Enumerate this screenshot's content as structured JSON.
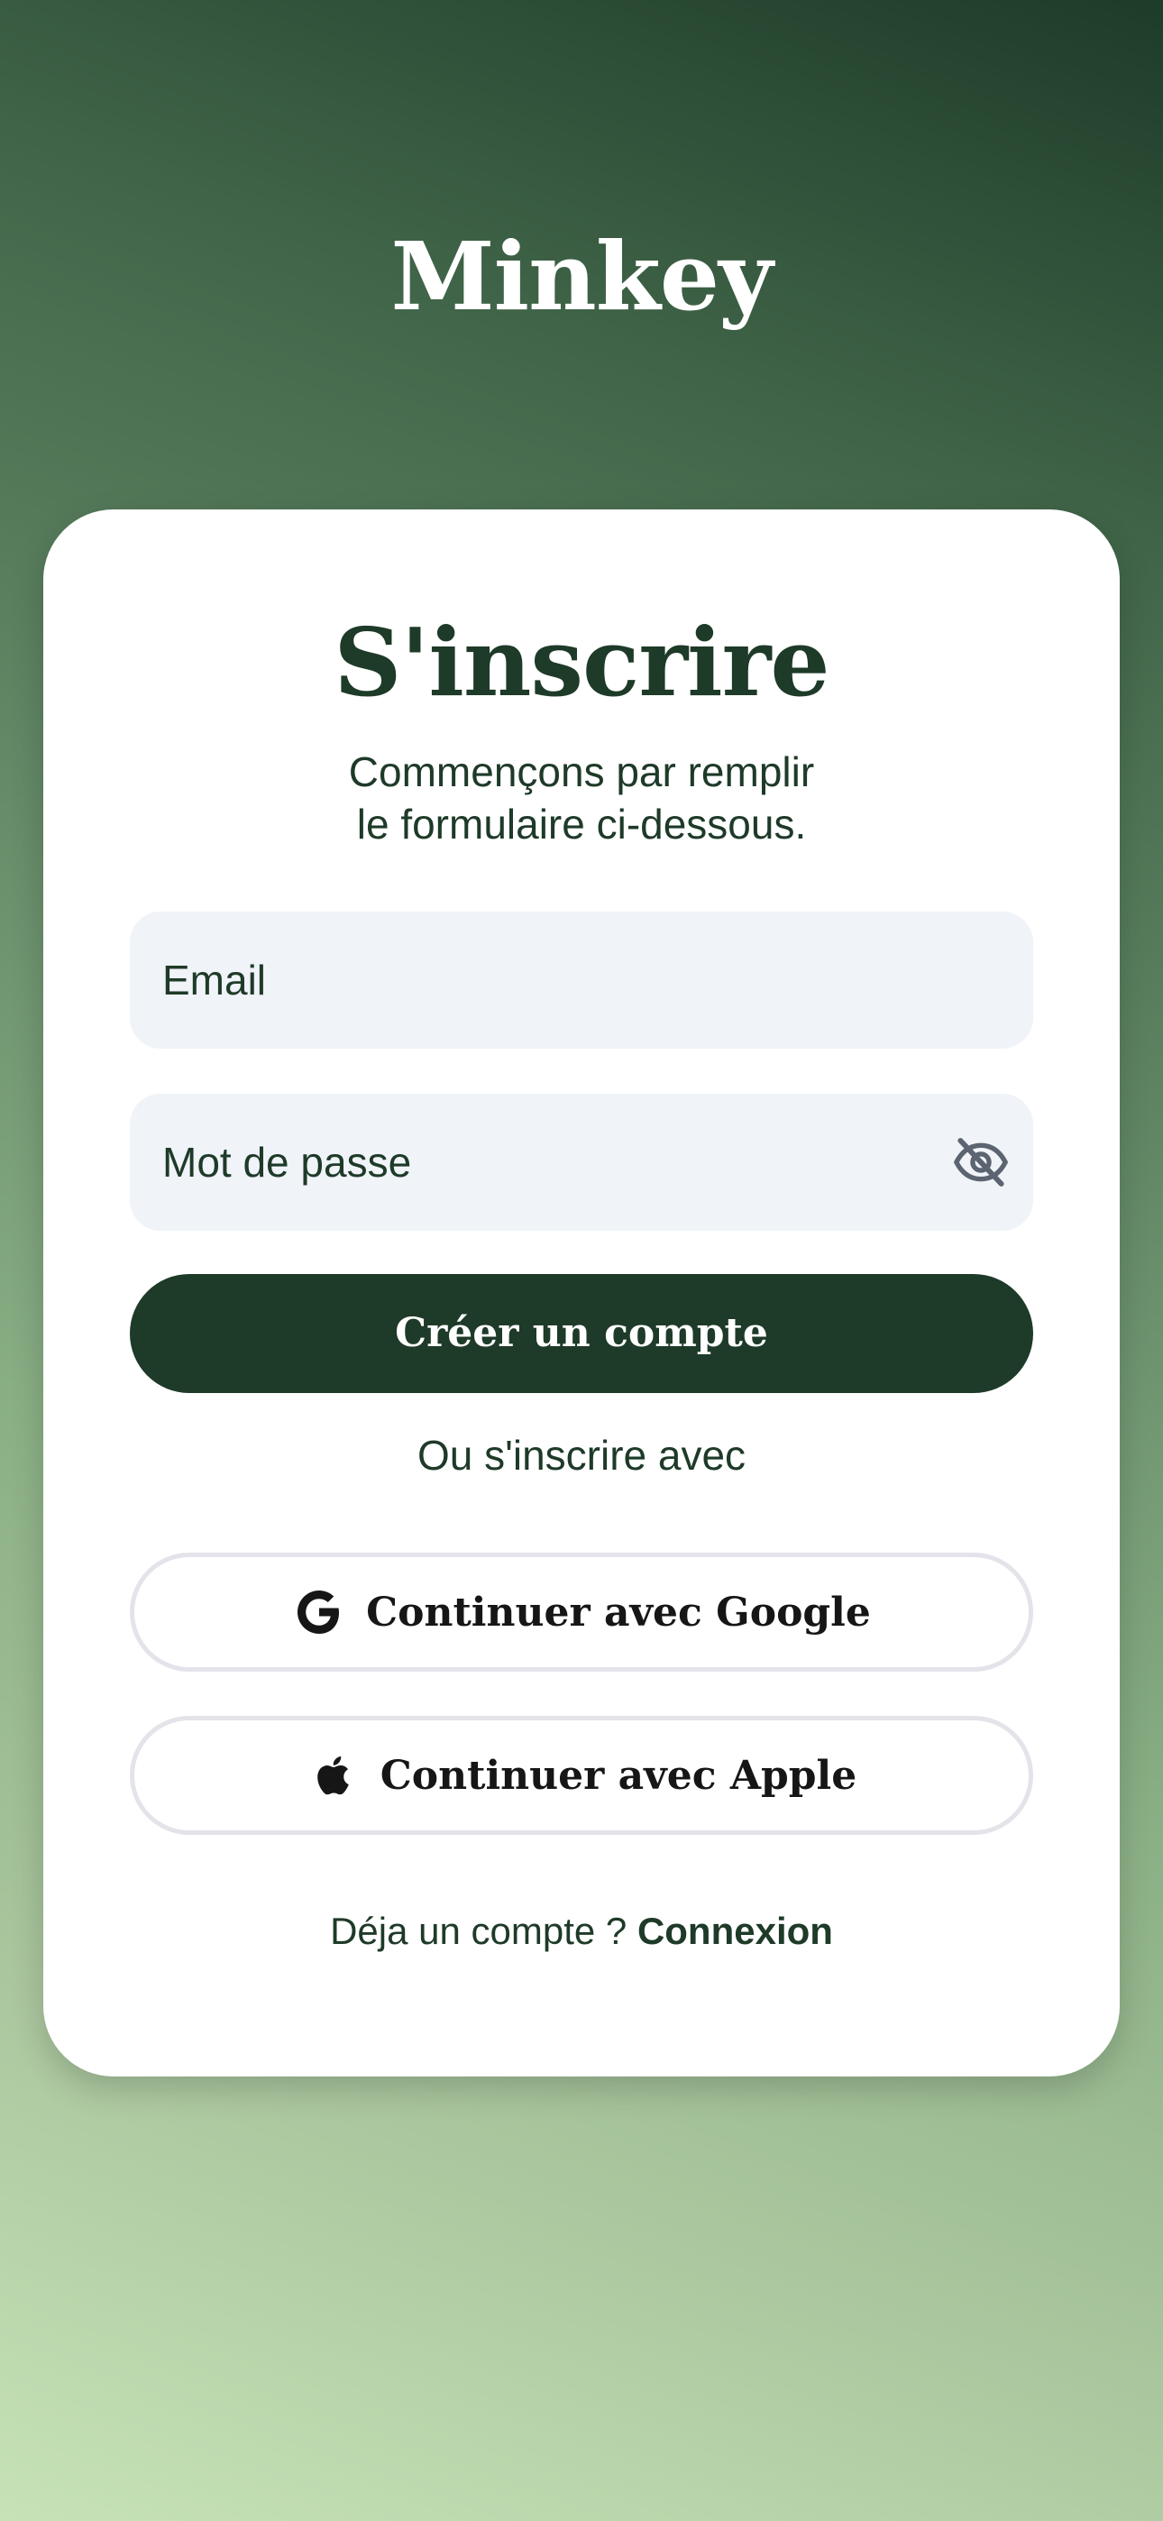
{
  "app": {
    "brand": "Minkey"
  },
  "signup": {
    "title": "S'inscrire",
    "subtitle_line1": "Commençons par remplir",
    "subtitle_line2": "le formulaire ci-dessous.",
    "email_placeholder": "Email",
    "password_placeholder": "Mot de passe",
    "password_toggle_icon": "eye-off-icon",
    "create_button": "Créer un compte",
    "or_text": "Ou s'inscrire avec",
    "google_button": "Continuer avec Google",
    "google_icon": "google-icon",
    "apple_button": "Continuer avec Apple",
    "apple_icon": "apple-icon",
    "footer_prompt": "Déja un compte ?",
    "footer_link": "Connexion"
  },
  "colors": {
    "primary": "#1e3a28",
    "field_bg": "#f0f3f8",
    "card_bg": "#ffffff",
    "outline": "#e3e3ea"
  }
}
